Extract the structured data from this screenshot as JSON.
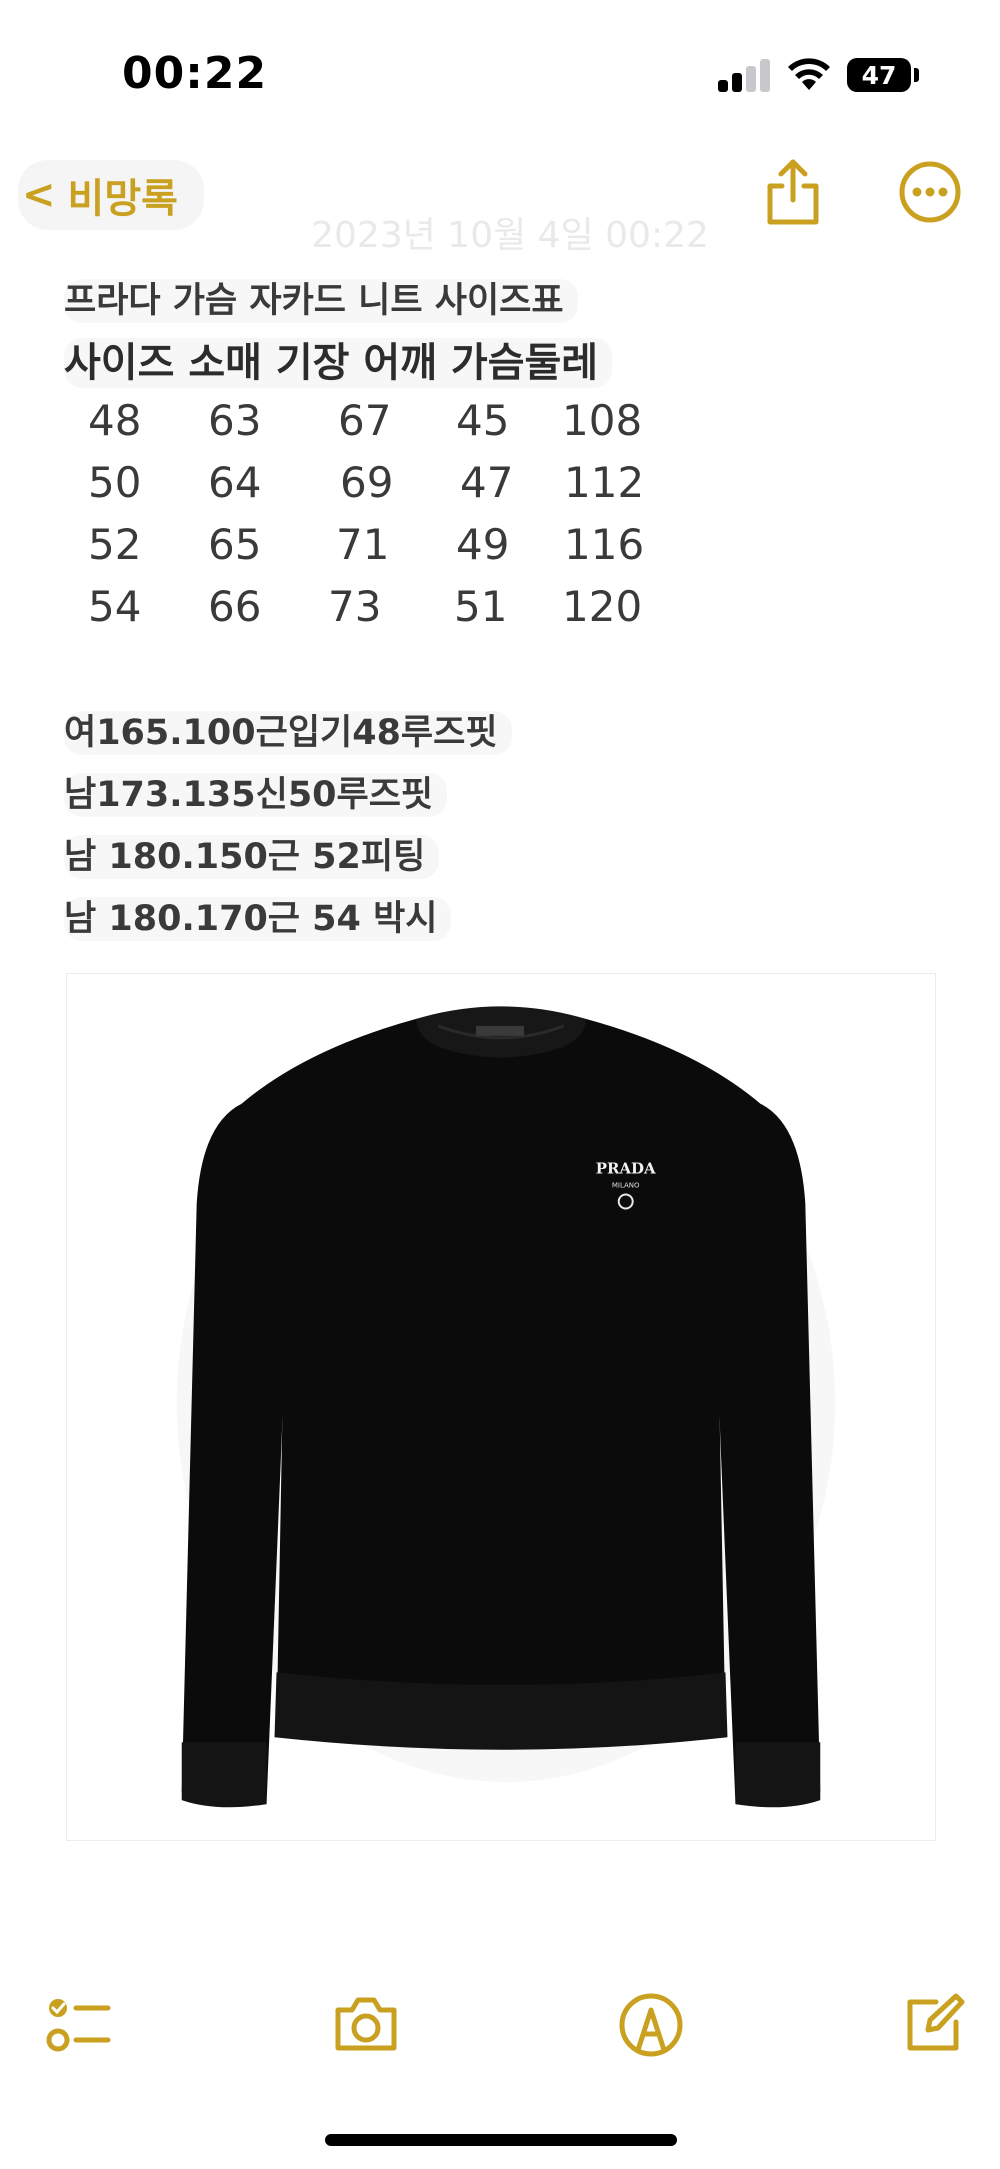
{
  "status": {
    "time": "00:22",
    "battery": "47"
  },
  "nav": {
    "back_label": "비망록",
    "date": "2023년 10월 4일 00:22"
  },
  "note": {
    "title": "프라다 가슴 자카드 니트 사이즈표",
    "header": "사이즈 소매 기장 어깨 가슴둘레",
    "size_rows": [
      [
        "48",
        "63",
        "67",
        "45",
        "108"
      ],
      [
        "50",
        "64",
        "69",
        "47",
        "112"
      ],
      [
        "52",
        "65",
        "71",
        "49",
        "116"
      ],
      [
        "54",
        "66",
        "73",
        "51",
        "120"
      ]
    ],
    "fit_notes": [
      "여165.100근입기48루즈핏",
      "남173.135신50루즈핏",
      "남 180.150근 52피팅",
      "남 180.170근 54 박시"
    ],
    "image": {
      "logo_text": "PRADA",
      "logo_sub": "MILANO"
    }
  },
  "colors": {
    "accent": "#c9a01f",
    "sweater": "#0b0b0b"
  },
  "icons": {
    "back": "chevron-left-icon",
    "share": "share-icon",
    "more": "more-icon",
    "checklist": "checklist-icon",
    "camera": "camera-icon",
    "markup": "markup-pen-icon",
    "compose": "compose-icon"
  }
}
